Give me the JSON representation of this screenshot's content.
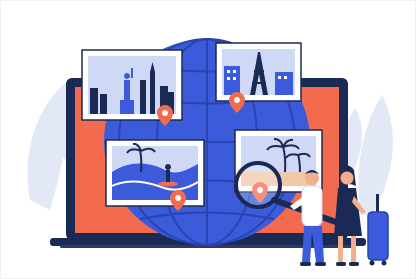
{
  "illustration": {
    "kind": "flat vector travel illustration",
    "palette": {
      "background": "#ffffff",
      "leaf": "#e3e8f6",
      "globe": "#3b5bdb",
      "globe_lines": "#2a43b0",
      "laptop_screen": "#f26b4f",
      "laptop_frame": "#1b2a55",
      "pin": "#f26b4f",
      "photo_frame": "#ffffff",
      "sky": "#cfd8f5",
      "navy": "#1b2a55",
      "skin": "#f0b08e",
      "suitcase": "#3b5bdb"
    },
    "icons": [
      "photo-frame-new-york",
      "photo-frame-paris",
      "photo-frame-surf",
      "photo-frame-tropical",
      "map-pin-icon",
      "magnifying-glass-icon",
      "suitcase-icon"
    ]
  }
}
